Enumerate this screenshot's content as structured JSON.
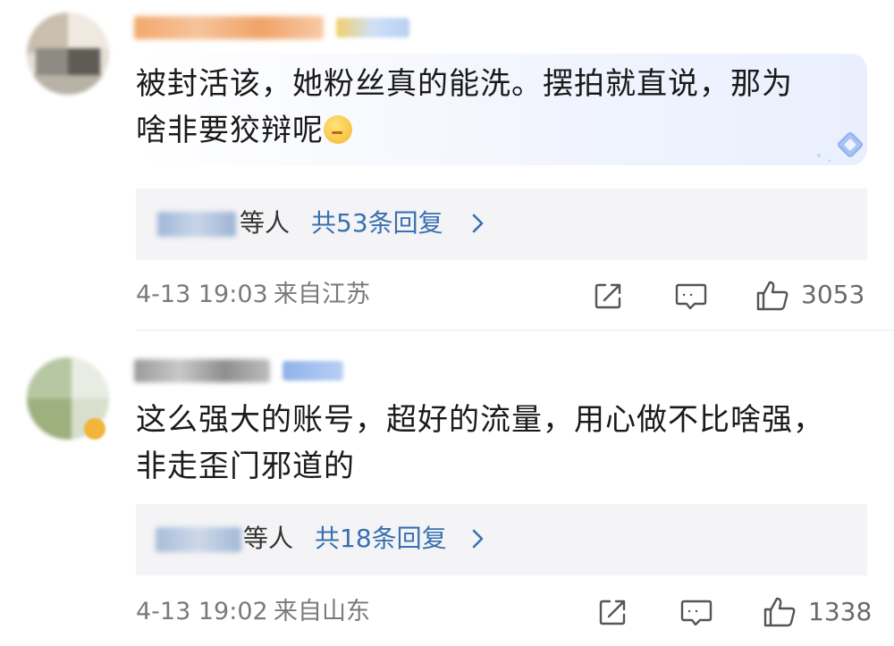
{
  "comments": [
    {
      "text_line1": "被封活该，她粉丝真的能洗。摆拍就直说，那为",
      "text_line2": "啥非要狡辩呢",
      "reply_others": "等人",
      "reply_count": "共53条回复",
      "date": "4-13 19:03",
      "location": "来自江苏",
      "likes": "3053"
    },
    {
      "text_line1": "这么强大的账号，超好的流量，用心做不比啥强，",
      "text_line2": "非走歪门邪道的",
      "reply_others": "等人",
      "reply_count": "共18条回复",
      "date": "4-13 19:02",
      "location": "来自山东",
      "likes": "1338"
    }
  ],
  "icons": {
    "emoji": "shushing-face-emoji",
    "share": "share-icon",
    "comment": "comment-icon",
    "like": "thumbs-up-icon",
    "chevron": "chevron-right-icon",
    "decoration": "diamond-decoration-icon"
  },
  "colors": {
    "link": "#3a6fb0",
    "meta": "#7a7a7a",
    "reply_bg": "#f4f4f6"
  }
}
